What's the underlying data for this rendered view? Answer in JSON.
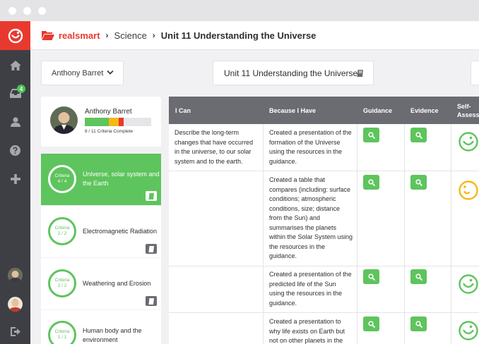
{
  "window": {
    "dots": [
      "red-dot",
      "amber-dot",
      "green-dot"
    ]
  },
  "nav": {
    "notification_count": "4",
    "icons": [
      "home-icon",
      "inbox-icon",
      "user-icon",
      "help-icon",
      "plus-icon",
      "logout-icon"
    ]
  },
  "breadcrumb": {
    "brand": "realsmart",
    "subject": "Science",
    "unit": "Unit 11 Understanding the Universe"
  },
  "student_select": {
    "value": "Anthony Barret"
  },
  "unit_header": {
    "title": "Unit 11 Understanding the Universe"
  },
  "profile": {
    "name": "Anthony Barret",
    "criteria_text": "8 / 11 Criteria Complete",
    "progress_segments": [
      {
        "fraction": 0.36,
        "color": "#5ec45d"
      },
      {
        "fraction": 0.15,
        "color": "#f5b814"
      },
      {
        "fraction": 0.08,
        "color": "#e8392f"
      }
    ]
  },
  "topics": [
    {
      "name": "Universe, solar system and the Earth",
      "criteria_label": "Criteria",
      "criteria_value": "4 / 4",
      "active": true
    },
    {
      "name": "Electromagnetic Radiation",
      "criteria_label": "Criteria",
      "criteria_value": "2 / 2",
      "active": false
    },
    {
      "name": "Weathering and Erosion",
      "criteria_label": "Criteria",
      "criteria_value": "2 / 2",
      "active": false
    },
    {
      "name": "Human body and the environment",
      "criteria_label": "Criteria",
      "criteria_value": "1 / 1",
      "active": false
    }
  ],
  "table": {
    "headers": {
      "i_can": "I Can",
      "because": "Because I Have",
      "guidance": "Guidance",
      "evidence": "Evidence",
      "self": "Self-Assess"
    },
    "rows": [
      {
        "i_can": "Describe the long-term changes that have occurred in the universe, to our solar system and to the earth.",
        "because": "Created a presentation of the formation of the Universe using the resources in the guidance.",
        "self_assess": "happy",
        "face_color": "#5ec45d"
      },
      {
        "i_can": "",
        "because": "Created a table that compares (including: surface conditions; atmospheric conditions, size; distance from the Sun) and summarises the planets within the Solar System using the resources in the guidance.",
        "self_assess": "neutral",
        "face_color": "#f5b814"
      },
      {
        "i_can": "",
        "because": "Created a presentation of the predicted life of the Sun using the resources in the guidance.",
        "self_assess": "happy",
        "face_color": "#5ec45d"
      },
      {
        "i_can": "",
        "because": "Created a presentation to why life exists on Earth but not on other planets in the",
        "self_assess": "happy",
        "face_color": "#5ec45d"
      }
    ]
  },
  "colors": {
    "accent_red": "#e8392f",
    "accent_green": "#5ec45d",
    "sidebar_dark": "#3e3f44",
    "header_grey": "#6b6c72"
  }
}
